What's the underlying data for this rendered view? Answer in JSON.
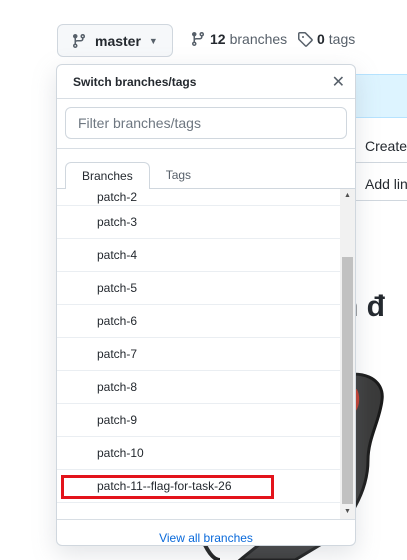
{
  "branch_button": {
    "label": "master"
  },
  "repo_meta": {
    "branches_count": "12",
    "branches_label": "branches",
    "tags_count": "0",
    "tags_label": "tags"
  },
  "background": {
    "row1": "Create",
    "row2": "Add lin",
    "heading": "n đ"
  },
  "dropdown": {
    "title": "Switch branches/tags",
    "filter_placeholder": "Filter branches/tags",
    "tabs": [
      {
        "label": "Branches",
        "active": true
      },
      {
        "label": "Tags",
        "active": false
      }
    ],
    "branches": [
      "patch-2",
      "patch-3",
      "patch-4",
      "patch-5",
      "patch-6",
      "patch-7",
      "patch-8",
      "patch-9",
      "patch-10",
      "patch-11--flag-for-task-26"
    ],
    "view_all_label": "View all branches"
  },
  "colors": {
    "link": "#0969da",
    "highlight": "#e3131b",
    "banner": "#ddf4ff"
  }
}
